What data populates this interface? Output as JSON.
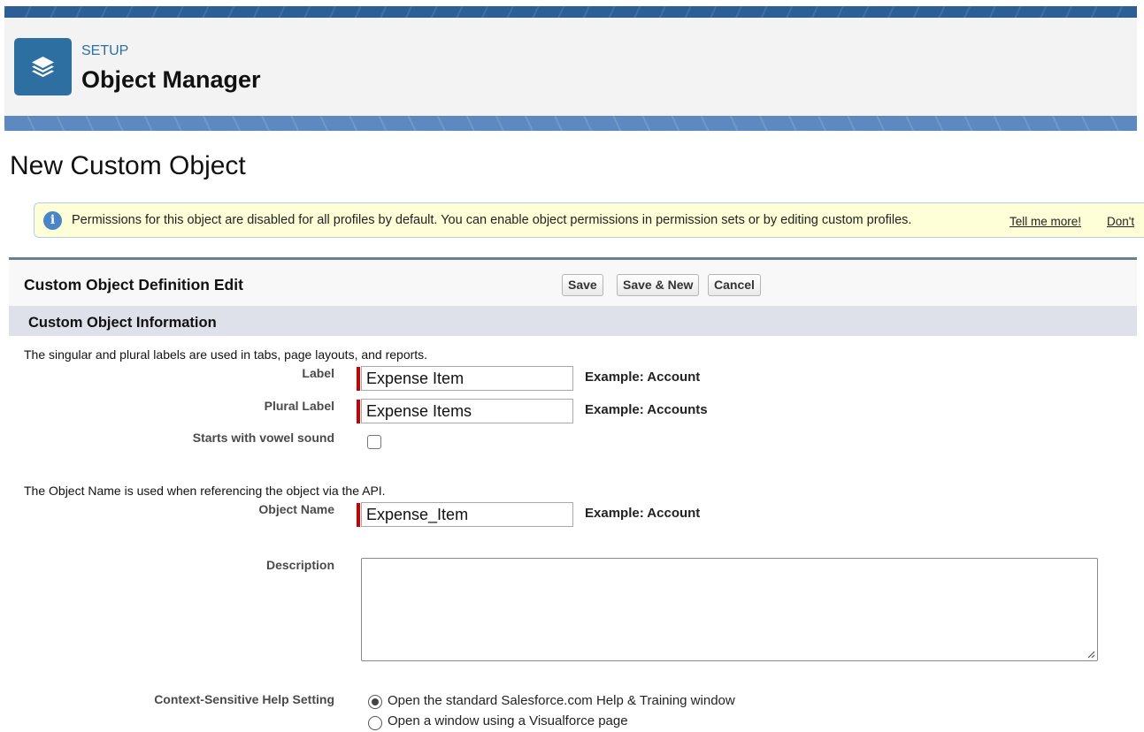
{
  "header": {
    "setup_label": "SETUP",
    "title": "Object Manager",
    "icon": "layers-icon",
    "brand_color": "#2d6fa1"
  },
  "page": {
    "title": "New Custom Object"
  },
  "info_banner": {
    "icon": "info-icon",
    "text": "Permissions for this object are disabled for all profiles by default. You can enable object permissions in permission sets or by editing custom profiles.",
    "link1": "Tell me more!",
    "link2": "Don't"
  },
  "panel": {
    "title": "Custom Object Definition Edit",
    "buttons": {
      "save": "Save",
      "save_new": "Save & New",
      "cancel": "Cancel"
    }
  },
  "section": {
    "title": "Custom Object Information",
    "labels_desc": "The singular and plural labels are used in tabs, page layouts, and reports.",
    "api_desc": "The Object Name is used when referencing the object via the API."
  },
  "fields": {
    "label": {
      "label": "Label",
      "value": "Expense Item",
      "example": "Example:  Account"
    },
    "plural_label": {
      "label": "Plural Label",
      "value": "Expense Items",
      "example": "Example:  Accounts"
    },
    "vowel": {
      "label": "Starts with vowel sound",
      "checked": false
    },
    "object_name": {
      "label": "Object Name",
      "value": "Expense_Item",
      "example": "Example:  Account"
    },
    "description": {
      "label": "Description",
      "value": ""
    },
    "help_setting": {
      "label": "Context-Sensitive Help Setting",
      "options": [
        {
          "text": "Open the standard Salesforce.com Help & Training window",
          "checked": true
        },
        {
          "text": "Open a window using a Visualforce page",
          "checked": false
        }
      ]
    }
  },
  "colors": {
    "required_marker": "#cc0000",
    "section_bg": "#dee1ea",
    "banner_bg": "#feffd6"
  }
}
